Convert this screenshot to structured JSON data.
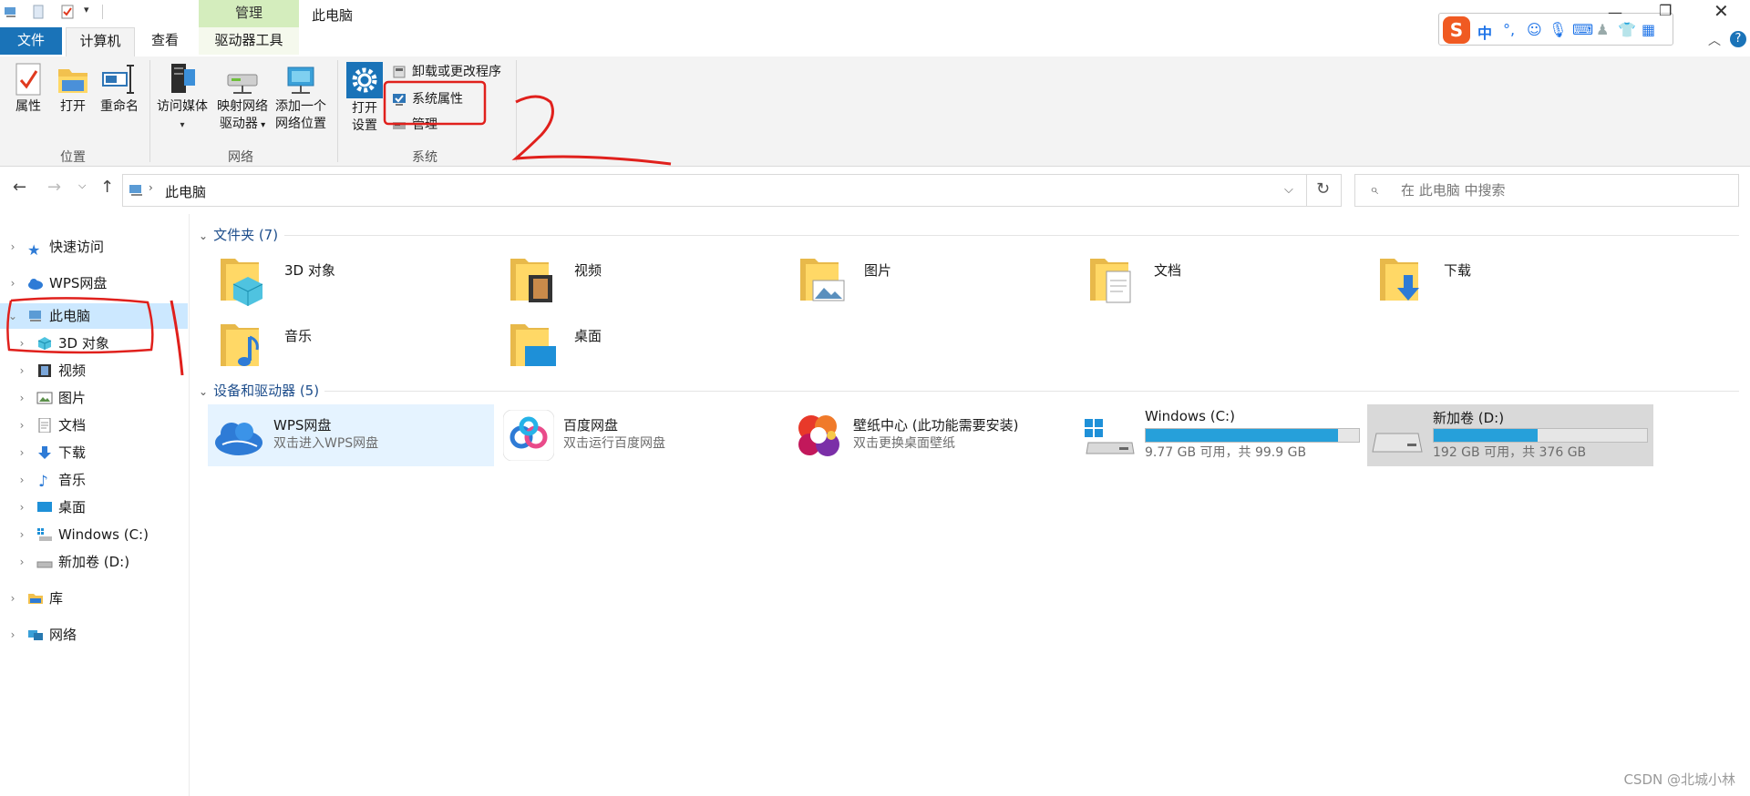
{
  "window": {
    "title": "此电脑",
    "contextual_group": "管理"
  },
  "tabs": [
    "文件",
    "计算机",
    "查看",
    "驱动器工具"
  ],
  "ribbon": {
    "groups": [
      "位置",
      "网络",
      "系统"
    ],
    "location": [
      "属性",
      "打开",
      "重命名"
    ],
    "network": {
      "access_media": "访问媒体",
      "map_drive_line1": "映射网络",
      "map_drive_line2": "驱动器",
      "add_location_line1": "添加一个",
      "add_location_line2": "网络位置"
    },
    "system": {
      "open_settings_line1": "打开",
      "open_settings_line2": "设置",
      "uninstall": "卸载或更改程序",
      "properties": "系统属性",
      "manage": "管理"
    }
  },
  "address": {
    "path": "此电脑",
    "search_placeholder": "在 此电脑 中搜索"
  },
  "nav": {
    "items": [
      {
        "label": "快速访问",
        "icon": "star-icon"
      },
      {
        "label": "WPS网盘",
        "icon": "cloud-icon"
      },
      {
        "label": "此电脑",
        "icon": "computer-icon"
      },
      {
        "label": "3D 对象",
        "icon": "cube-icon"
      },
      {
        "label": "视频",
        "icon": "film-icon"
      },
      {
        "label": "图片",
        "icon": "picture-icon"
      },
      {
        "label": "文档",
        "icon": "document-icon"
      },
      {
        "label": "下载",
        "icon": "download-icon"
      },
      {
        "label": "音乐",
        "icon": "music-icon"
      },
      {
        "label": "桌面",
        "icon": "desktop-icon"
      },
      {
        "label": "Windows (C:)",
        "icon": "system-drive-icon"
      },
      {
        "label": "新加卷 (D:)",
        "icon": "drive-icon"
      },
      {
        "label": "库",
        "icon": "library-icon"
      },
      {
        "label": "网络",
        "icon": "network-icon"
      }
    ]
  },
  "content": {
    "folders_header": "文件夹 (7)",
    "folders": [
      "3D 对象",
      "视频",
      "图片",
      "文档",
      "下载",
      "音乐",
      "桌面"
    ],
    "devices_header": "设备和驱动器 (5)",
    "devices": [
      {
        "name": "WPS网盘",
        "subtitle": "双击进入WPS网盘"
      },
      {
        "name": "百度网盘",
        "subtitle": "双击运行百度网盘"
      },
      {
        "name": "壁纸中心 (此功能需要安装)",
        "subtitle": "双击更换桌面壁纸"
      }
    ],
    "drives": [
      {
        "name": "Windows (C:)",
        "info": "9.77 GB 可用，共 99.9 GB",
        "used_fraction": 0.902,
        "bar_color": "#26a0da"
      },
      {
        "name": "新加卷 (D:)",
        "info": "192 GB 可用，共 376 GB",
        "used_fraction": 0.489,
        "bar_color": "#26a0da"
      }
    ]
  },
  "annotations": {
    "color": "#e0201c",
    "numbers": [
      "1",
      "2"
    ]
  },
  "watermark": "CSDN @北城小林",
  "colors": {
    "accent": "#1a73b8",
    "selection": "#cce8ff",
    "hover": "#e5f3ff",
    "manage_tab": "#d4edbd"
  }
}
